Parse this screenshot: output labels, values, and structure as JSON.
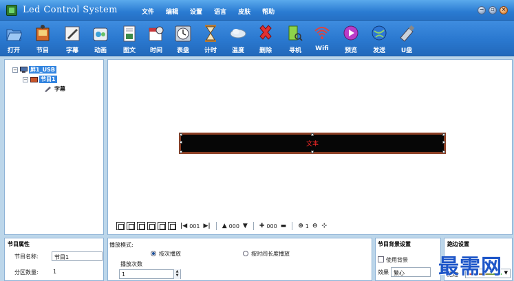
{
  "app": {
    "title": "Led Control System",
    "watermark": "最需网"
  },
  "menu": [
    "文件",
    "编辑",
    "设置",
    "语言",
    "皮肤",
    "帮助"
  ],
  "toolbar": [
    {
      "label": "打开",
      "icon": "folder-open-icon"
    },
    {
      "label": "节目",
      "icon": "program-icon"
    },
    {
      "label": "字幕",
      "icon": "subtitle-pen-icon"
    },
    {
      "label": "动画",
      "icon": "animation-icon"
    },
    {
      "label": "图文",
      "icon": "image-text-icon"
    },
    {
      "label": "时间",
      "icon": "calendar-icon"
    },
    {
      "label": "表盘",
      "icon": "clock-dial-icon"
    },
    {
      "label": "计时",
      "icon": "hourglass-icon"
    },
    {
      "label": "温度",
      "icon": "cloud-temperature-icon"
    },
    {
      "label": "删除",
      "icon": "delete-x-icon"
    },
    {
      "label": "寻机",
      "icon": "search-device-icon"
    },
    {
      "label": "Wifi",
      "icon": "wifi-icon"
    },
    {
      "label": "预览",
      "icon": "preview-play-icon"
    },
    {
      "label": "发送",
      "icon": "send-globe-icon"
    },
    {
      "label": "U盘",
      "icon": "usb-drive-icon"
    }
  ],
  "tree": {
    "screen": "屏1_USB",
    "program": "节目1",
    "item": "字幕"
  },
  "canvas": {
    "led_text": "文本"
  },
  "zoombar": {
    "x_value": "001",
    "y_value": "000",
    "width_value": "000",
    "zoom_value": "1"
  },
  "program_props": {
    "title": "节目属性",
    "name_label": "节目名称:",
    "name_value": "节目1",
    "partition_label": "分区数量:",
    "partition_value": "1"
  },
  "play_mode": {
    "title": "播放模式:",
    "by_count": "按次播放",
    "by_duration": "按时间长度播放",
    "count_label": "播放次数",
    "count_value": "1"
  },
  "bg_settings": {
    "title": "节目背景设置",
    "use_bg": "使用背景",
    "effect_label": "效果",
    "effect_value": "繁心"
  },
  "border_settings": {
    "title": "跑边设置",
    "border_label": "跑边"
  }
}
